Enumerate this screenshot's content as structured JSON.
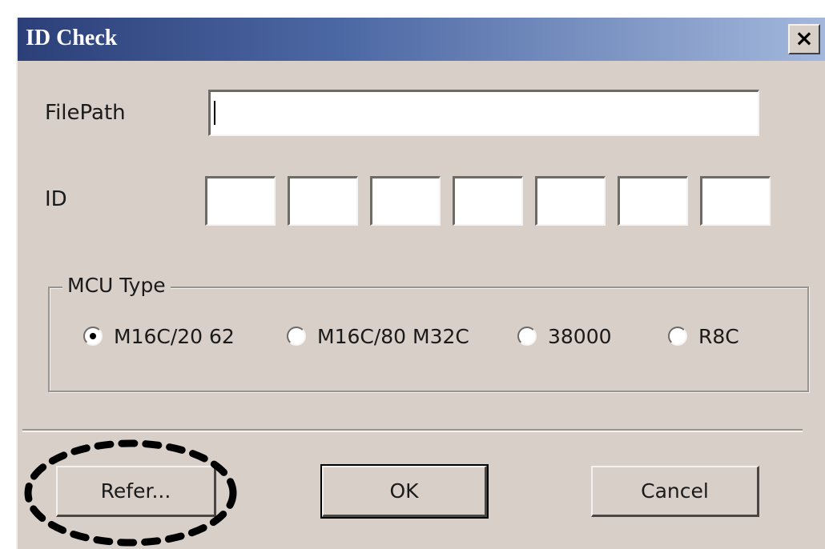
{
  "window": {
    "title": "ID Check",
    "close_glyph": "×"
  },
  "form": {
    "filepath_label": "FilePath",
    "filepath_value": "",
    "id_label": "ID",
    "id_fields": [
      "",
      "",
      "",
      "",
      "",
      "",
      ""
    ]
  },
  "mcu_type": {
    "legend": "MCU Type",
    "options": [
      {
        "label": "M16C/20 62",
        "selected": true
      },
      {
        "label": "M16C/80 M32C",
        "selected": false
      },
      {
        "label": "38000",
        "selected": false
      },
      {
        "label": "R8C",
        "selected": false
      }
    ]
  },
  "buttons": {
    "refer": "Refer...",
    "ok": "OK",
    "cancel": "Cancel"
  },
  "annotation": {
    "highlight_color": "#000000",
    "highlight_target": "refer-button"
  },
  "icons": {
    "close": "close-icon"
  }
}
